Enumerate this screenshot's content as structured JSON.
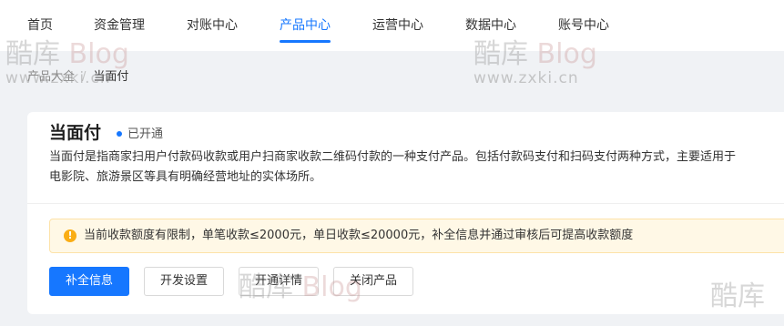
{
  "nav": {
    "items": [
      {
        "label": "首页"
      },
      {
        "label": "资金管理"
      },
      {
        "label": "对账中心"
      },
      {
        "label": "产品中心",
        "active": true
      },
      {
        "label": "运营中心"
      },
      {
        "label": "数据中心"
      },
      {
        "label": "账号中心"
      }
    ]
  },
  "breadcrumb": {
    "parent": "产品大全",
    "separator": "/",
    "current": "当面付"
  },
  "product": {
    "title": "当面付",
    "status": "已开通",
    "description_line1": "当面付是指商家扫用户付款码收款或用户扫商家收款二维码付款的一种支付产品。包括付款码支付和扫码支付两种方式，主要适用于",
    "description_line2": "电影院、旅游景区等具有明确经营地址的实体场所。"
  },
  "alert": {
    "icon": "warning-icon",
    "icon_glyph": "!",
    "text": "当前收款额度有限制，单笔收款≤2000元，单日收款≤20000元，补全信息并通过审核后可提高收款额度"
  },
  "actions": {
    "complete_info": "补全信息",
    "dev_settings": "开发设置",
    "activation_details": "开通详情",
    "close_product": "关闭产品"
  },
  "watermark": {
    "brand_a": "酷库",
    "brand_b": "Blog",
    "url": "www.zxki.cn",
    "brand_partial": "酷库"
  },
  "colors": {
    "accent": "#1677ff",
    "warning": "#faad14",
    "alert_bg": "#fff8e6"
  }
}
